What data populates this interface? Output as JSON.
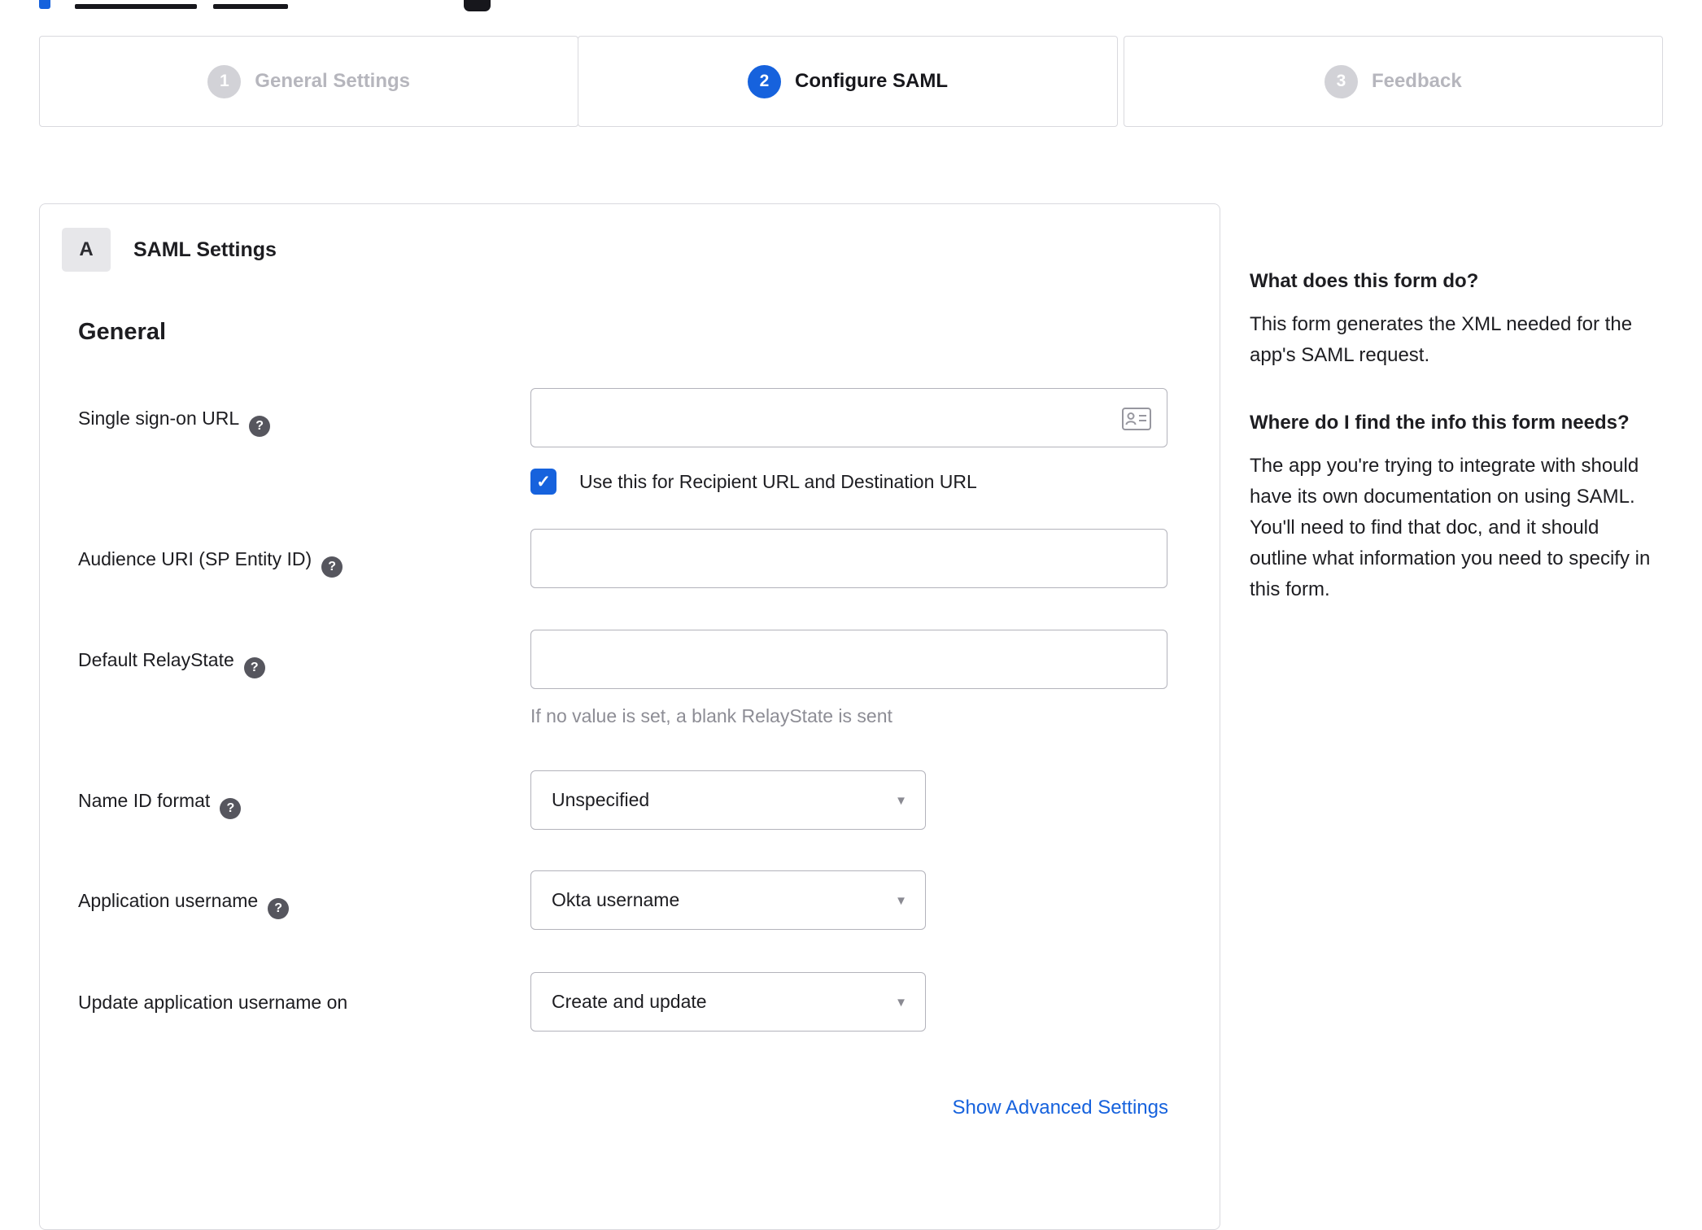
{
  "stepper": {
    "steps": [
      {
        "number": "1",
        "label": "General Settings",
        "state": "inactive"
      },
      {
        "number": "2",
        "label": "Configure SAML",
        "state": "active"
      },
      {
        "number": "3",
        "label": "Feedback",
        "state": "inactive"
      }
    ]
  },
  "panel": {
    "section_badge": "A",
    "section_title": "SAML Settings",
    "group_heading": "General",
    "fields": {
      "sso_url": {
        "label": "Single sign-on URL",
        "value": "",
        "checkbox_checked": true,
        "checkbox_label": "Use this for Recipient URL and Destination URL"
      },
      "audience_uri": {
        "label": "Audience URI (SP Entity ID)",
        "value": ""
      },
      "relay_state": {
        "label": "Default RelayState",
        "value": "",
        "hint": "If no value is set, a blank RelayState is sent"
      },
      "name_id_format": {
        "label": "Name ID format",
        "value": "Unspecified"
      },
      "app_username": {
        "label": "Application username",
        "value": "Okta username"
      },
      "update_app_username": {
        "label": "Update application username on",
        "value": "Create and update"
      }
    },
    "advanced_link": "Show Advanced Settings"
  },
  "sidebar": {
    "sections": [
      {
        "heading": "What does this form do?",
        "body": "This form generates the XML needed for the app's SAML request."
      },
      {
        "heading": "Where do I find the info this form needs?",
        "body": "The app you're trying to integrate with should have its own documentation on using SAML. You'll need to find that doc, and it should outline what information you need to specify in this form."
      }
    ]
  },
  "icons": {
    "help": "?",
    "check": "✓",
    "dropdown_arrow": "▼"
  },
  "colors": {
    "accent_blue": "#1662dd",
    "inactive_gray": "#d2d2d7",
    "text_dark": "#1d1d21",
    "muted_gray": "#8d8d95",
    "border_gray": "#d9d9de",
    "input_border": "#b3b3bb"
  }
}
